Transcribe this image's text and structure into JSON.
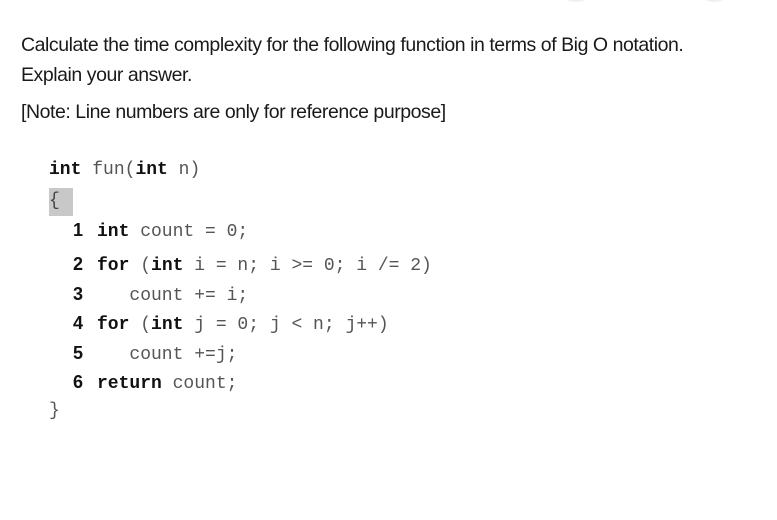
{
  "question": {
    "prompt_line1": "Calculate the time complexity for the following function in terms of Big O notation.",
    "prompt_line2": "Explain your answer.",
    "note": "[Note: Line numbers are only for reference purpose]"
  },
  "code": {
    "signature": {
      "return_type": "int",
      "name": "fun",
      "open_paren": "(",
      "param_type": "int",
      "param_name": "n",
      "close_paren": ")"
    },
    "open_brace": "{",
    "close_brace": "}",
    "lines": [
      {
        "number": "1",
        "keyword": "int",
        "rest": " count = 0;"
      },
      {
        "number": "2",
        "keyword": "for",
        "mid": " (",
        "keyword2": "int",
        "rest": " i = n; i >= 0; i /= 2)"
      },
      {
        "number": "3",
        "rest": "   count += i;"
      },
      {
        "number": "4",
        "keyword": "for",
        "mid": " (",
        "keyword2": "int",
        "rest": " j = 0; j < n; j++)"
      },
      {
        "number": "5",
        "rest": "   count +=j;"
      },
      {
        "number": "6",
        "keyword": "return",
        "rest": " count;"
      }
    ]
  }
}
